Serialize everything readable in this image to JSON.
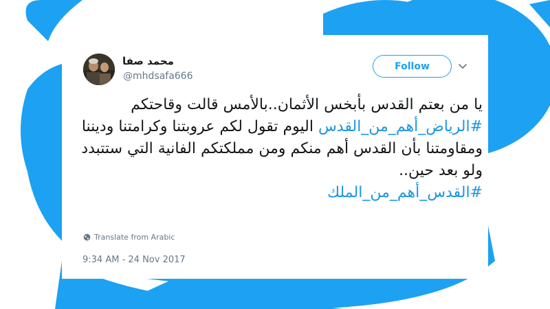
{
  "tweet": {
    "author": {
      "display_name": "محمد صفا",
      "handle": "@mhdsafa666"
    },
    "follow_label": "Follow",
    "body": {
      "segments": [
        {
          "type": "text",
          "text": "يا من بعتم القدس بأبخس الأثمان..بالأمس قالت وقاحتكم "
        },
        {
          "type": "hashtag",
          "text": "#الرياض_أهم_من_القدس"
        },
        {
          "type": "text",
          "text": " اليوم تقول لكم عروبتنا وكرامتنا وديننا ومقاومتنا بأن القدس أهم منكم ومن مملكتكم الفانية التي ستتبدد ولو بعد حين.."
        }
      ],
      "closing_hashtag": "#القدس_أهم_من_الملك"
    },
    "translate_label": "Translate from Arabic",
    "timestamp": "9:34 AM - 24 Nov 2017"
  },
  "colors": {
    "brand_blue": "#1da1f2",
    "hashtag_blue": "#1b95e0",
    "text_primary": "#14171a",
    "text_secondary": "#657786"
  },
  "icons": {
    "caret": "chevron-down-icon",
    "translate": "globe-icon",
    "background": "twitter-bird-logo"
  }
}
